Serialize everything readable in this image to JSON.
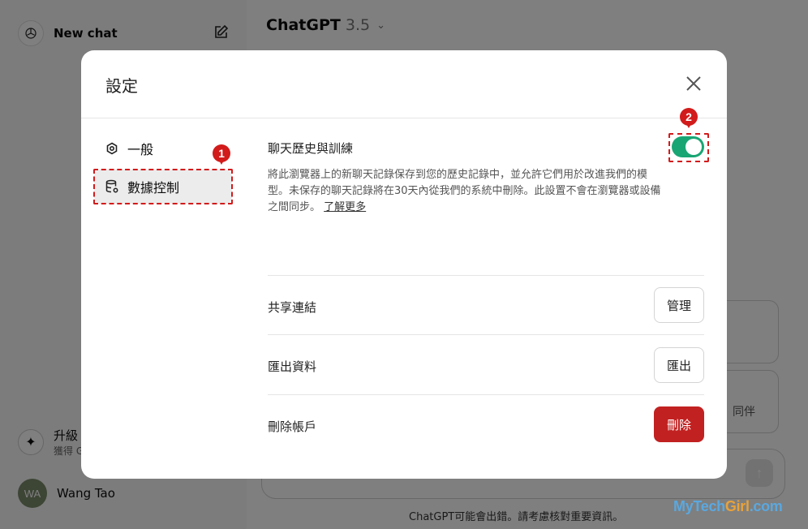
{
  "sidebar": {
    "new_chat_label": "New chat",
    "upgrade_title": "升級",
    "upgrade_sub": "獲得 G",
    "user_initials": "WA",
    "user_name": "Wang Tao"
  },
  "header": {
    "model_name": "ChatGPT",
    "model_version": "3.5"
  },
  "background": {
    "card_text": "同伴",
    "footer_notice": "ChatGPT可能會出錯。請考慮核對重要資訊。",
    "watermark_a": "MyTech",
    "watermark_b": "Girl",
    "watermark_c": ".com"
  },
  "modal": {
    "title": "設定",
    "nav": [
      {
        "label": "一般",
        "icon": "gear-icon"
      },
      {
        "label": "數據控制",
        "icon": "database-icon"
      }
    ],
    "annotations": {
      "badge1": "1",
      "badge2": "2",
      "color": "#d21b1b"
    },
    "history": {
      "title": "聊天歷史與訓練",
      "enabled": true,
      "description": "將此瀏覽器上的新聊天記錄保存到您的歷史記錄中，並允許它們用於改進我們的模型。未保存的聊天記錄將在30天內從我們的系統中刪除。此設置不會在瀏覽器或設備之間同步。",
      "learn_more": "了解更多",
      "toggle_color": "#19a674"
    },
    "shared_links": {
      "label": "共享連結",
      "button": "管理"
    },
    "export": {
      "label": "匯出資料",
      "button": "匯出"
    },
    "delete": {
      "label": "刪除帳戶",
      "button": "刪除",
      "button_color": "#c22121"
    }
  }
}
